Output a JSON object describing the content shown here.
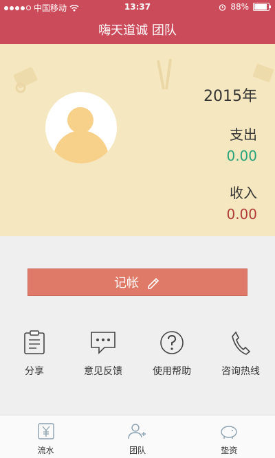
{
  "status_bar": {
    "carrier": "中国移动",
    "time": "13:37",
    "battery": "88%",
    "battery_level": 0.88
  },
  "header": {
    "title": "嗨天道诚 团队"
  },
  "summary": {
    "year": "2015年",
    "expense_label": "支出",
    "expense_value": "0.00",
    "income_label": "收入",
    "income_value": "0.00"
  },
  "record_button": {
    "label": "记帐"
  },
  "actions": [
    {
      "label": "分享",
      "icon": "share-doc-icon"
    },
    {
      "label": "意见反馈",
      "icon": "feedback-bubble-icon"
    },
    {
      "label": "使用帮助",
      "icon": "help-icon"
    },
    {
      "label": "咨询热线",
      "icon": "phone-icon"
    }
  ],
  "tabs": [
    {
      "label": "流水",
      "icon": "yen-doc-icon"
    },
    {
      "label": "团队",
      "icon": "add-user-icon"
    },
    {
      "label": "垫资",
      "icon": "piggy-bank-icon"
    }
  ],
  "colors": {
    "header": "#cc4b5a",
    "hero_bg": "#f5e8c0",
    "button": "#e07a68",
    "expense": "#2aa37a",
    "income": "#b13a3a"
  }
}
